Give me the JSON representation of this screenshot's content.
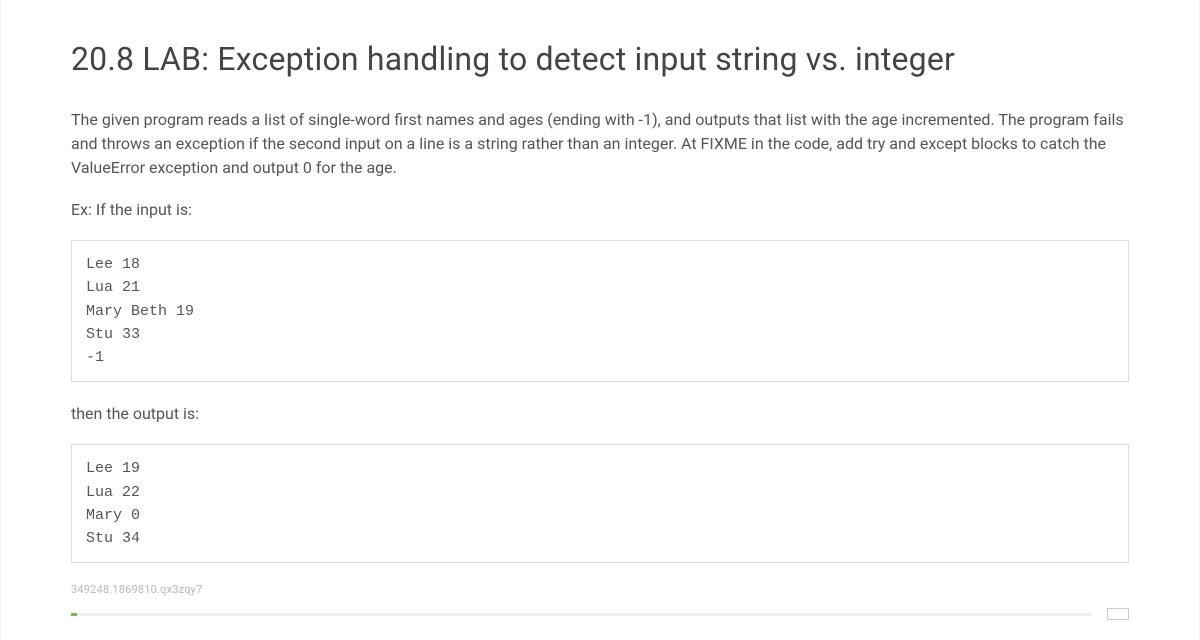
{
  "title": "20.8 LAB: Exception handling to detect input string vs. integer",
  "description": "The given program reads a list of single-word first names and ages (ending with -1), and outputs that list with the age incremented. The program fails and throws an exception if the second input on a line is a string rather than an integer. At FIXME in the code, add try and except blocks to catch the ValueError exception and output 0 for the age.",
  "example_prompt": "Ex: If the input is:",
  "input_block": "Lee 18\nLua 21\nMary Beth 19\nStu 33\n-1",
  "then_text": "then the output is:",
  "output_block": "Lee 19\nLua 22\nMary 0\nStu 34",
  "footer_code": "349248.1869810.qx3zqy7"
}
